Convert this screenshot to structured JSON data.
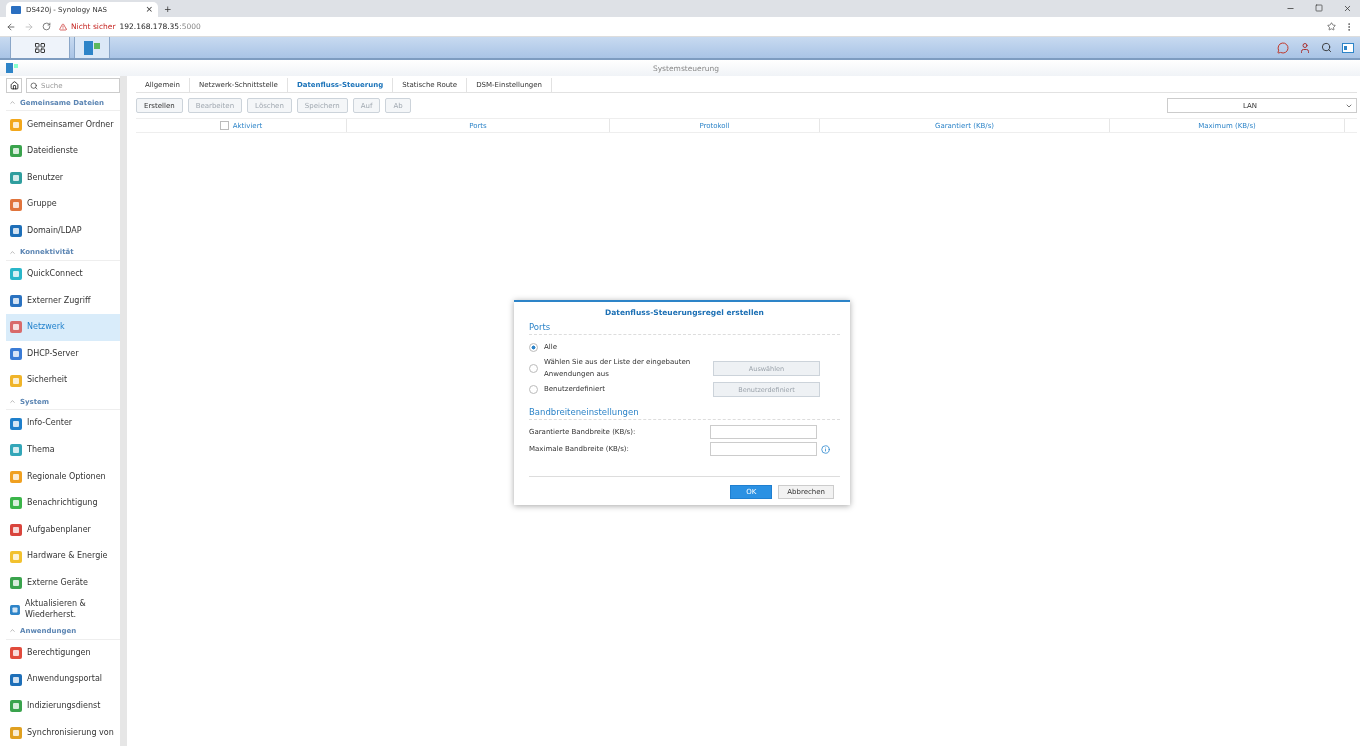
{
  "browser": {
    "tab_title": "DS420j - Synology NAS",
    "tab_close": "×",
    "new_tab": "+",
    "security": "Nicht sicher",
    "url_host": "192.168.178.35",
    "url_port": ":5000"
  },
  "window": {
    "title": "Systemsteuerung"
  },
  "sidebar": {
    "search": {
      "placeholder": "Suche"
    },
    "sections": [
      {
        "title": "Gemeinsame Dateien",
        "expanded": true,
        "items": [
          {
            "label": "Gemeinsamer Ordner",
            "selected": false
          },
          {
            "label": "Dateidienste",
            "selected": false
          },
          {
            "label": "Benutzer",
            "selected": false
          },
          {
            "label": "Gruppe",
            "selected": false
          },
          {
            "label": "Domain/LDAP",
            "selected": false
          }
        ]
      },
      {
        "title": "Konnektivität",
        "expanded": true,
        "items": [
          {
            "label": "QuickConnect",
            "selected": false
          },
          {
            "label": "Externer Zugriff",
            "selected": false
          },
          {
            "label": "Netzwerk",
            "selected": true
          },
          {
            "label": "DHCP-Server",
            "selected": false
          },
          {
            "label": "Sicherheit",
            "selected": false
          }
        ]
      },
      {
        "title": "System",
        "expanded": true,
        "items": [
          {
            "label": "Info-Center",
            "selected": false
          },
          {
            "label": "Thema",
            "selected": false
          },
          {
            "label": "Regionale Optionen",
            "selected": false
          },
          {
            "label": "Benachrichtigung",
            "selected": false
          },
          {
            "label": "Aufgabenplaner",
            "selected": false
          },
          {
            "label": "Hardware & Energie",
            "selected": false
          },
          {
            "label": "Externe Geräte",
            "selected": false
          },
          {
            "label": "Aktualisieren & Wiederherst.",
            "selected": false
          }
        ]
      },
      {
        "title": "Anwendungen",
        "expanded": true,
        "items": [
          {
            "label": "Berechtigungen",
            "selected": false
          },
          {
            "label": "Anwendungsportal",
            "selected": false
          },
          {
            "label": "Indizierungsdienst",
            "selected": false
          },
          {
            "label": "Synchronisierung von",
            "selected": false
          }
        ]
      }
    ]
  },
  "tabs": [
    {
      "label": "Allgemein",
      "selected": false
    },
    {
      "label": "Netzwerk-Schnittstelle",
      "selected": false
    },
    {
      "label": "Datenfluss-Steuerung",
      "selected": true
    },
    {
      "label": "Statische Route",
      "selected": false
    },
    {
      "label": "DSM-Einstellungen",
      "selected": false
    }
  ],
  "toolbar": {
    "buttons": [
      {
        "label": "Erstellen",
        "disabled": false
      },
      {
        "label": "Bearbeiten",
        "disabled": true
      },
      {
        "label": "Löschen",
        "disabled": true
      },
      {
        "label": "Speichern",
        "disabled": true
      },
      {
        "label": "Auf",
        "disabled": true
      },
      {
        "label": "Ab",
        "disabled": true
      }
    ],
    "interface_select": {
      "value": "LAN"
    }
  },
  "table": {
    "select_all_checked": false,
    "columns": [
      "Aktiviert",
      "Ports",
      "Protokoll",
      "Garantiert (KB/s)",
      "Maximum (KB/s)"
    ]
  },
  "dialog": {
    "title": "Datenfluss-Steuerungsregel erstellen",
    "ports": {
      "heading": "Ports",
      "options": [
        {
          "label": "Alle",
          "selected": true
        },
        {
          "label": "Wählen Sie aus der Liste der eingebauten Anwendungen aus",
          "selected": false,
          "button": {
            "label": "Auswählen",
            "disabled": true
          }
        },
        {
          "label": "Benutzerdefiniert",
          "selected": false,
          "button": {
            "label": "Benutzerdefiniert",
            "disabled": true
          }
        }
      ]
    },
    "bandwidth": {
      "heading": "Bandbreiteneinstellungen",
      "fields": [
        {
          "label": "Garantierte Bandbreite (KB/s):",
          "info": false
        },
        {
          "label": "Maximale Bandbreite (KB/s):",
          "info": true
        }
      ]
    },
    "buttons": [
      {
        "label": "OK",
        "primary": true
      },
      {
        "label": "Abbrechen",
        "primary": false
      }
    ]
  }
}
